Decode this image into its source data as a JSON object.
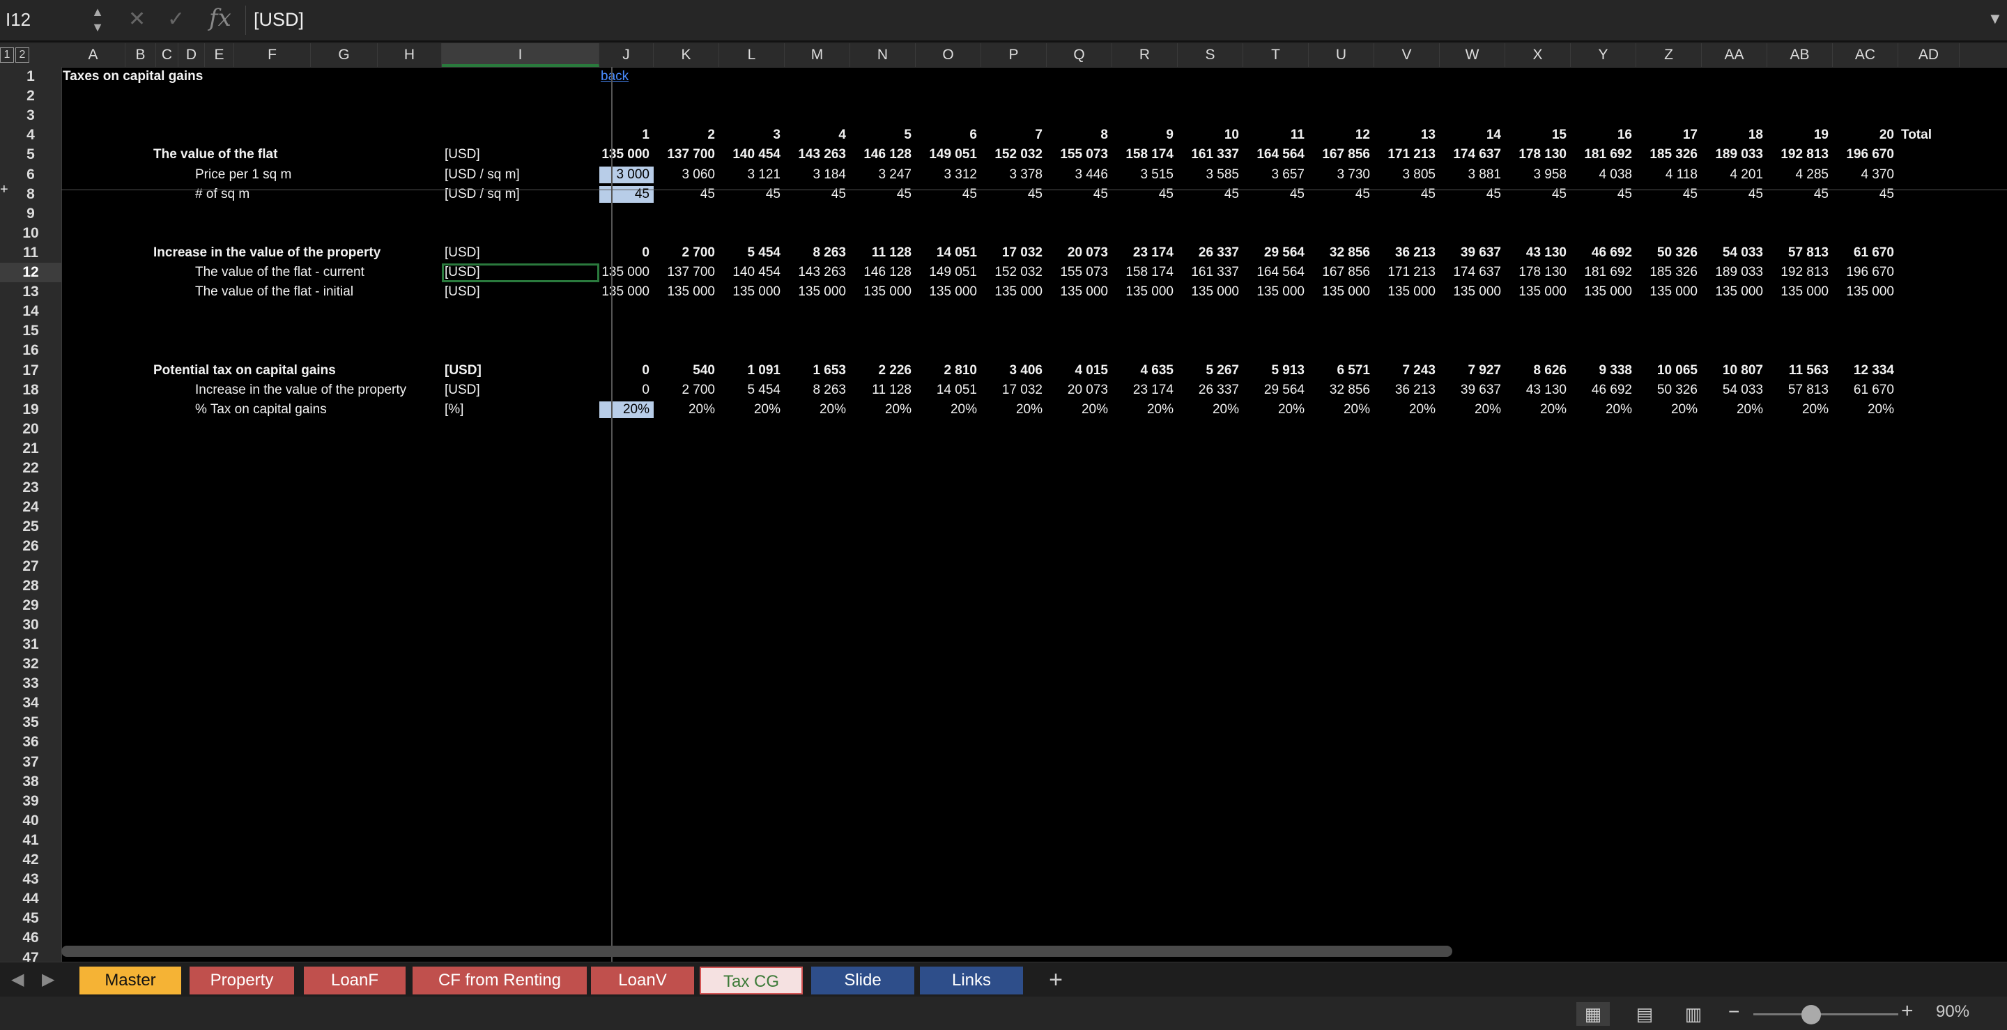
{
  "formula_bar": {
    "name_box": "I12",
    "content": "[USD]"
  },
  "outline_levels": [
    "1",
    "2"
  ],
  "columns": [
    "A",
    "B",
    "C",
    "D",
    "E",
    "F",
    "G",
    "H",
    "I",
    "J",
    "K",
    "L",
    "M",
    "N",
    "O",
    "P",
    "Q",
    "R",
    "S",
    "T",
    "U",
    "V",
    "W",
    "X",
    "Y",
    "Z",
    "AA",
    "AB",
    "AC",
    "AD"
  ],
  "selected_column": "I",
  "rows": [
    "1",
    "2",
    "3",
    "4",
    "5",
    "6",
    "8",
    "9",
    "10",
    "11",
    "12",
    "13",
    "14",
    "15",
    "16",
    "17",
    "18",
    "19",
    "20",
    "21",
    "22",
    "23",
    "24",
    "25",
    "26",
    "27",
    "28",
    "29",
    "30",
    "31",
    "32",
    "33",
    "34",
    "35",
    "36",
    "37",
    "38",
    "39",
    "40",
    "41",
    "42",
    "43",
    "44",
    "45",
    "46",
    "47"
  ],
  "selected_row": "12",
  "sheet": {
    "title": "Taxes on capital gains",
    "back_link": "back",
    "periods": [
      "1",
      "2",
      "3",
      "4",
      "5",
      "6",
      "7",
      "8",
      "9",
      "10",
      "11",
      "12",
      "13",
      "14",
      "15",
      "16",
      "17",
      "18",
      "19",
      "20"
    ],
    "total_label": "Total",
    "sections": [
      {
        "row": "5",
        "label": "The value of the flat",
        "unit": "[USD]",
        "bold": true,
        "values": [
          "135 000",
          "137 700",
          "140 454",
          "143 263",
          "146 128",
          "149 051",
          "152 032",
          "155 073",
          "158 174",
          "161 337",
          "164 564",
          "167 856",
          "171 213",
          "174 637",
          "178 130",
          "181 692",
          "185 326",
          "189 033",
          "192 813",
          "196 670"
        ]
      },
      {
        "row": "6",
        "label": "Price per 1 sq m",
        "unit": "[USD / sq m]",
        "bold": false,
        "highlight_first": true,
        "values": [
          "3 000",
          "3 060",
          "3 121",
          "3 184",
          "3 247",
          "3 312",
          "3 378",
          "3 446",
          "3 515",
          "3 585",
          "3 657",
          "3 730",
          "3 805",
          "3 881",
          "3 958",
          "4 038",
          "4 118",
          "4 201",
          "4 285",
          "4 370"
        ]
      },
      {
        "row": "8",
        "label": "# of sq m",
        "unit": "[USD / sq m]",
        "bold": false,
        "highlight_first": true,
        "values": [
          "45",
          "45",
          "45",
          "45",
          "45",
          "45",
          "45",
          "45",
          "45",
          "45",
          "45",
          "45",
          "45",
          "45",
          "45",
          "45",
          "45",
          "45",
          "45",
          "45"
        ]
      },
      {
        "row": "11",
        "label": "Increase in the value of the property",
        "unit": "[USD]",
        "bold": true,
        "values": [
          "0",
          "2 700",
          "5 454",
          "8 263",
          "11 128",
          "14 051",
          "17 032",
          "20 073",
          "23 174",
          "26 337",
          "29 564",
          "32 856",
          "36 213",
          "39 637",
          "43 130",
          "46 692",
          "50 326",
          "54 033",
          "57 813",
          "61 670"
        ]
      },
      {
        "row": "12",
        "label": "The value of the flat - current",
        "unit": "[USD]",
        "bold": false,
        "values": [
          "135 000",
          "137 700",
          "140 454",
          "143 263",
          "146 128",
          "149 051",
          "152 032",
          "155 073",
          "158 174",
          "161 337",
          "164 564",
          "167 856",
          "171 213",
          "174 637",
          "178 130",
          "181 692",
          "185 326",
          "189 033",
          "192 813",
          "196 670"
        ]
      },
      {
        "row": "13",
        "label": "The value of the flat - initial",
        "unit": "[USD]",
        "bold": false,
        "values": [
          "135 000",
          "135 000",
          "135 000",
          "135 000",
          "135 000",
          "135 000",
          "135 000",
          "135 000",
          "135 000",
          "135 000",
          "135 000",
          "135 000",
          "135 000",
          "135 000",
          "135 000",
          "135 000",
          "135 000",
          "135 000",
          "135 000",
          "135 000"
        ]
      },
      {
        "row": "17",
        "label": "Potential tax on capital gains",
        "unit": "[USD]",
        "bold": true,
        "values": [
          "0",
          "540",
          "1 091",
          "1 653",
          "2 226",
          "2 810",
          "3 406",
          "4 015",
          "4 635",
          "5 267",
          "5 913",
          "6 571",
          "7 243",
          "7 927",
          "8 626",
          "9 338",
          "10 065",
          "10 807",
          "11 563",
          "12 334"
        ]
      },
      {
        "row": "18",
        "label": "Increase in the value of the property",
        "unit": "[USD]",
        "bold": false,
        "values": [
          "0",
          "2 700",
          "5 454",
          "8 263",
          "11 128",
          "14 051",
          "17 032",
          "20 073",
          "23 174",
          "26 337",
          "29 564",
          "32 856",
          "36 213",
          "39 637",
          "43 130",
          "46 692",
          "50 326",
          "54 033",
          "57 813",
          "61 670"
        ]
      },
      {
        "row": "19",
        "label": "% Tax on capital gains",
        "unit": "[%]",
        "bold": false,
        "highlight_first": true,
        "values": [
          "20%",
          "20%",
          "20%",
          "20%",
          "20%",
          "20%",
          "20%",
          "20%",
          "20%",
          "20%",
          "20%",
          "20%",
          "20%",
          "20%",
          "20%",
          "20%",
          "20%",
          "20%",
          "20%",
          "20%"
        ]
      }
    ]
  },
  "tabs": [
    {
      "label": "Master",
      "color": "#f5b335",
      "text_color": "#111111",
      "active": false
    },
    {
      "label": "Property",
      "color": "#c0504d",
      "text_color": "#ffffff",
      "active": false
    },
    {
      "label": "LoanF",
      "color": "#c0504d",
      "text_color": "#ffffff",
      "active": false
    },
    {
      "label": "CF from Renting",
      "color": "#c0504d",
      "text_color": "#ffffff",
      "active": false
    },
    {
      "label": "LoanV",
      "color": "#c0504d",
      "text_color": "#ffffff",
      "active": false
    },
    {
      "label": "Tax CG",
      "color": "#f5e1e1",
      "text_color": "#3c7a38",
      "active": true
    },
    {
      "label": "Slide",
      "color": "#2e4e8a",
      "text_color": "#ffffff",
      "active": false
    },
    {
      "label": "Links",
      "color": "#2e4e8a",
      "text_color": "#ffffff",
      "active": false
    }
  ],
  "status": {
    "zoom": "90%",
    "zoom_level": 0.4
  },
  "icons": [
    "close-icon",
    "checkmark-icon",
    "fx-icon",
    "expand-chevron-icon",
    "prev-sheet-icon",
    "next-sheet-icon",
    "add-sheet-icon",
    "normal-view-icon",
    "page-layout-icon",
    "page-break-icon",
    "zoom-out-icon",
    "zoom-in-icon"
  ]
}
